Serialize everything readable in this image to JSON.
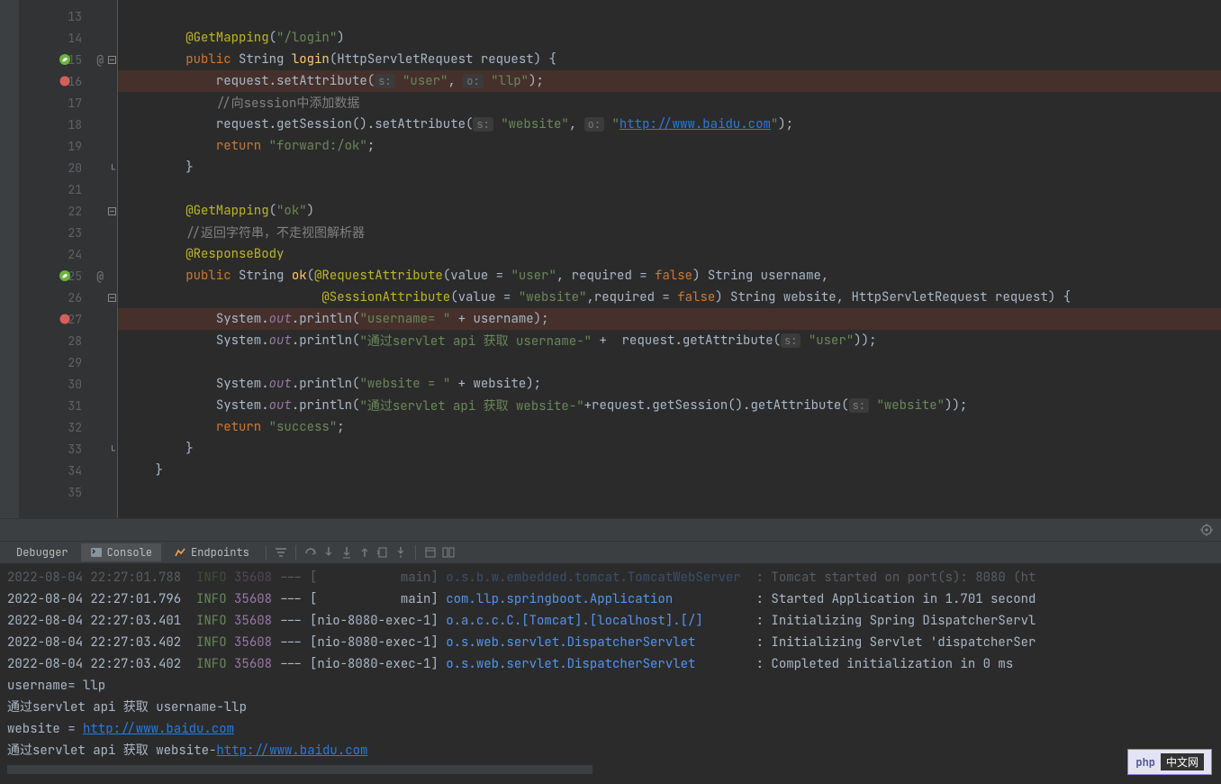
{
  "lines": [
    {
      "n": 13,
      "tokens": []
    },
    {
      "n": 14,
      "indent": 8,
      "tokens": [
        {
          "t": "annotation",
          "v": "@GetMapping"
        },
        {
          "t": "parens",
          "v": "("
        },
        {
          "t": "string",
          "v": "\"/login\""
        },
        {
          "t": "parens",
          "v": ")"
        }
      ]
    },
    {
      "n": 15,
      "icon": "spring",
      "at": true,
      "fold": "-",
      "indent": 8,
      "tokens": [
        {
          "t": "keyword",
          "v": "public"
        },
        {
          "t": "default",
          "v": " String "
        },
        {
          "t": "method-decl",
          "v": "login"
        },
        {
          "t": "parens",
          "v": "("
        },
        {
          "t": "default",
          "v": "HttpServletRequest request"
        },
        {
          "t": "parens",
          "v": ")"
        },
        {
          "t": "default",
          "v": " {"
        }
      ]
    },
    {
      "n": 16,
      "icon": "breakpoint",
      "hl": true,
      "indent": 12,
      "tokens": [
        {
          "t": "default",
          "v": "request.setAttribute("
        },
        {
          "t": "hint",
          "v": "s:"
        },
        {
          "t": "default",
          "v": " "
        },
        {
          "t": "string",
          "v": "\"user\""
        },
        {
          "t": "default",
          "v": ", "
        },
        {
          "t": "hint",
          "v": "o:"
        },
        {
          "t": "default",
          "v": " "
        },
        {
          "t": "string",
          "v": "\"llp\""
        },
        {
          "t": "parens",
          "v": ")"
        },
        {
          "t": "default",
          "v": ";"
        }
      ]
    },
    {
      "n": 17,
      "indent": 12,
      "tokens": [
        {
          "t": "comment",
          "v": "//向session中添加数据"
        }
      ]
    },
    {
      "n": 18,
      "indent": 12,
      "tokens": [
        {
          "t": "default",
          "v": "request.getSession().setAttribute("
        },
        {
          "t": "hint",
          "v": "s:"
        },
        {
          "t": "default",
          "v": " "
        },
        {
          "t": "string",
          "v": "\"website\""
        },
        {
          "t": "default",
          "v": ", "
        },
        {
          "t": "hint",
          "v": "o:"
        },
        {
          "t": "default",
          "v": " "
        },
        {
          "t": "string",
          "v": "\""
        },
        {
          "t": "link",
          "v": "http://www.baidu.com"
        },
        {
          "t": "string",
          "v": "\""
        },
        {
          "t": "parens",
          "v": ")"
        },
        {
          "t": "default",
          "v": ";"
        }
      ]
    },
    {
      "n": 19,
      "indent": 12,
      "tokens": [
        {
          "t": "keyword",
          "v": "return "
        },
        {
          "t": "string",
          "v": "\"forward:/ok\""
        },
        {
          "t": "default",
          "v": ";"
        }
      ]
    },
    {
      "n": 20,
      "fold": "^",
      "indent": 8,
      "tokens": [
        {
          "t": "default",
          "v": "}"
        }
      ]
    },
    {
      "n": 21,
      "tokens": []
    },
    {
      "n": 22,
      "fold": "-",
      "indent": 8,
      "tokens": [
        {
          "t": "annotation",
          "v": "@GetMapping"
        },
        {
          "t": "parens",
          "v": "("
        },
        {
          "t": "string",
          "v": "\"ok\""
        },
        {
          "t": "parens",
          "v": ")"
        }
      ]
    },
    {
      "n": 23,
      "indent": 8,
      "tokens": [
        {
          "t": "comment",
          "v": "//返回字符串，不走视图解析器"
        }
      ]
    },
    {
      "n": 24,
      "indent": 8,
      "tokens": [
        {
          "t": "annotation",
          "v": "@ResponseBody"
        }
      ]
    },
    {
      "n": 25,
      "icon": "spring",
      "at": true,
      "indent": 8,
      "tokens": [
        {
          "t": "keyword",
          "v": "public"
        },
        {
          "t": "default",
          "v": " String "
        },
        {
          "t": "method-decl",
          "v": "ok"
        },
        {
          "t": "parens",
          "v": "("
        },
        {
          "t": "annotation",
          "v": "@RequestAttribute"
        },
        {
          "t": "parens",
          "v": "("
        },
        {
          "t": "default",
          "v": "value = "
        },
        {
          "t": "string",
          "v": "\"user\""
        },
        {
          "t": "default",
          "v": ", required = "
        },
        {
          "t": "keyword",
          "v": "false"
        },
        {
          "t": "parens",
          "v": ")"
        },
        {
          "t": "default",
          "v": " String username,"
        }
      ]
    },
    {
      "n": 26,
      "fold": "-",
      "indent": 26,
      "tokens": [
        {
          "t": "annotation",
          "v": "@SessionAttribute"
        },
        {
          "t": "parens",
          "v": "("
        },
        {
          "t": "default",
          "v": "value = "
        },
        {
          "t": "string",
          "v": "\"website\""
        },
        {
          "t": "default",
          "v": ",required = "
        },
        {
          "t": "keyword",
          "v": "false"
        },
        {
          "t": "parens",
          "v": ")"
        },
        {
          "t": "default",
          "v": " String website, HttpServletRequest request"
        },
        {
          "t": "parens",
          "v": ")"
        },
        {
          "t": "default",
          "v": " {"
        }
      ]
    },
    {
      "n": 27,
      "icon": "breakpoint",
      "hl": true,
      "indent": 12,
      "tokens": [
        {
          "t": "default",
          "v": "System."
        },
        {
          "t": "field",
          "v": "out"
        },
        {
          "t": "default",
          "v": ".println("
        },
        {
          "t": "string",
          "v": "\"username= \""
        },
        {
          "t": "default",
          "v": " + username"
        },
        {
          "t": "parens",
          "v": ")"
        },
        {
          "t": "default",
          "v": ";"
        }
      ]
    },
    {
      "n": 28,
      "indent": 12,
      "tokens": [
        {
          "t": "default",
          "v": "System."
        },
        {
          "t": "field",
          "v": "out"
        },
        {
          "t": "default",
          "v": ".println("
        },
        {
          "t": "string",
          "v": "\"通过servlet api 获取 username-\""
        },
        {
          "t": "default",
          "v": " +  request.getAttribute("
        },
        {
          "t": "hint",
          "v": "s:"
        },
        {
          "t": "default",
          "v": " "
        },
        {
          "t": "string",
          "v": "\"user\""
        },
        {
          "t": "parens",
          "v": "))"
        },
        {
          "t": "default",
          "v": ";"
        }
      ]
    },
    {
      "n": 29,
      "tokens": []
    },
    {
      "n": 30,
      "indent": 12,
      "tokens": [
        {
          "t": "default",
          "v": "System."
        },
        {
          "t": "field",
          "v": "out"
        },
        {
          "t": "default",
          "v": ".println("
        },
        {
          "t": "string",
          "v": "\"website = \""
        },
        {
          "t": "default",
          "v": " + website"
        },
        {
          "t": "parens",
          "v": ")"
        },
        {
          "t": "default",
          "v": ";"
        }
      ]
    },
    {
      "n": 31,
      "indent": 12,
      "tokens": [
        {
          "t": "default",
          "v": "System."
        },
        {
          "t": "field",
          "v": "out"
        },
        {
          "t": "default",
          "v": ".println("
        },
        {
          "t": "string",
          "v": "\"通过servlet api 获取 website-\""
        },
        {
          "t": "default",
          "v": "+request.getSession().getAttribute("
        },
        {
          "t": "hint",
          "v": "s:"
        },
        {
          "t": "default",
          "v": " "
        },
        {
          "t": "string",
          "v": "\"website\""
        },
        {
          "t": "parens",
          "v": "))"
        },
        {
          "t": "default",
          "v": ";"
        }
      ]
    },
    {
      "n": 32,
      "indent": 12,
      "tokens": [
        {
          "t": "keyword",
          "v": "return "
        },
        {
          "t": "string",
          "v": "\"success\""
        },
        {
          "t": "default",
          "v": ";"
        }
      ]
    },
    {
      "n": 33,
      "fold": "^",
      "indent": 8,
      "tokens": [
        {
          "t": "default",
          "v": "}"
        }
      ]
    },
    {
      "n": 34,
      "indent": 4,
      "tokens": [
        {
          "t": "default",
          "v": "}"
        }
      ]
    },
    {
      "n": 35,
      "tokens": []
    }
  ],
  "tabs": {
    "debugger": "Debugger",
    "console": "Console",
    "endpoints": "Endpoints"
  },
  "console": {
    "logs": [
      {
        "ts": "2022-08-04 22:27:01.788",
        "lvl": "INFO",
        "pid": "35608",
        "thread": "[           main]",
        "logger": "o.s.b.w.embedded.tomcat.TomcatWebServer",
        "msg": ": Tomcat started on port(s): 8080 (ht",
        "cut": true
      },
      {
        "ts": "2022-08-04 22:27:01.796",
        "lvl": "INFO",
        "pid": "35608",
        "thread": "[           main]",
        "logger": "com.llp.springboot.Application",
        "msg": ": Started Application in 1.701 second"
      },
      {
        "ts": "2022-08-04 22:27:03.401",
        "lvl": "INFO",
        "pid": "35608",
        "thread": "[nio-8080-exec-1]",
        "logger": "o.a.c.c.C.[Tomcat].[localhost].[/]",
        "msg": ": Initializing Spring DispatcherServl"
      },
      {
        "ts": "2022-08-04 22:27:03.402",
        "lvl": "INFO",
        "pid": "35608",
        "thread": "[nio-8080-exec-1]",
        "logger": "o.s.web.servlet.DispatcherServlet",
        "msg": ": Initializing Servlet 'dispatcherSer"
      },
      {
        "ts": "2022-08-04 22:27:03.402",
        "lvl": "INFO",
        "pid": "35608",
        "thread": "[nio-8080-exec-1]",
        "logger": "o.s.web.servlet.DispatcherServlet",
        "msg": ": Completed initialization in 0 ms"
      }
    ],
    "out": [
      {
        "plain": "username= llp"
      },
      {
        "plain": "通过servlet api 获取 username-llp"
      },
      {
        "prefix": "website = ",
        "url": "http://www.baidu.com"
      },
      {
        "prefix": "通过servlet api 获取 website-",
        "url": "http://www.baidu.com"
      }
    ]
  },
  "watermark": {
    "a": "php",
    "b": "中文网"
  }
}
